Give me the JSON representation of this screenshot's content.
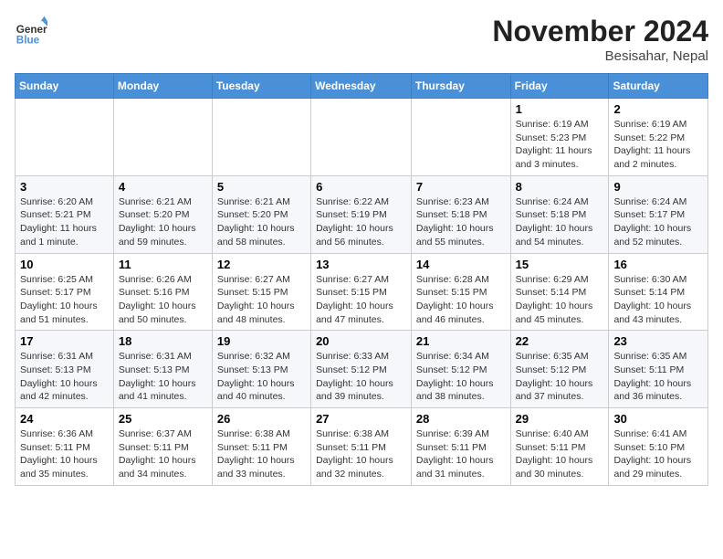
{
  "logo": {
    "line1": "General",
    "line2": "Blue"
  },
  "title": "November 2024",
  "location": "Besisahar, Nepal",
  "weekdays": [
    "Sunday",
    "Monday",
    "Tuesday",
    "Wednesday",
    "Thursday",
    "Friday",
    "Saturday"
  ],
  "weeks": [
    [
      {
        "day": "",
        "info": ""
      },
      {
        "day": "",
        "info": ""
      },
      {
        "day": "",
        "info": ""
      },
      {
        "day": "",
        "info": ""
      },
      {
        "day": "",
        "info": ""
      },
      {
        "day": "1",
        "info": "Sunrise: 6:19 AM\nSunset: 5:23 PM\nDaylight: 11 hours and 3 minutes."
      },
      {
        "day": "2",
        "info": "Sunrise: 6:19 AM\nSunset: 5:22 PM\nDaylight: 11 hours and 2 minutes."
      }
    ],
    [
      {
        "day": "3",
        "info": "Sunrise: 6:20 AM\nSunset: 5:21 PM\nDaylight: 11 hours and 1 minute."
      },
      {
        "day": "4",
        "info": "Sunrise: 6:21 AM\nSunset: 5:20 PM\nDaylight: 10 hours and 59 minutes."
      },
      {
        "day": "5",
        "info": "Sunrise: 6:21 AM\nSunset: 5:20 PM\nDaylight: 10 hours and 58 minutes."
      },
      {
        "day": "6",
        "info": "Sunrise: 6:22 AM\nSunset: 5:19 PM\nDaylight: 10 hours and 56 minutes."
      },
      {
        "day": "7",
        "info": "Sunrise: 6:23 AM\nSunset: 5:18 PM\nDaylight: 10 hours and 55 minutes."
      },
      {
        "day": "8",
        "info": "Sunrise: 6:24 AM\nSunset: 5:18 PM\nDaylight: 10 hours and 54 minutes."
      },
      {
        "day": "9",
        "info": "Sunrise: 6:24 AM\nSunset: 5:17 PM\nDaylight: 10 hours and 52 minutes."
      }
    ],
    [
      {
        "day": "10",
        "info": "Sunrise: 6:25 AM\nSunset: 5:17 PM\nDaylight: 10 hours and 51 minutes."
      },
      {
        "day": "11",
        "info": "Sunrise: 6:26 AM\nSunset: 5:16 PM\nDaylight: 10 hours and 50 minutes."
      },
      {
        "day": "12",
        "info": "Sunrise: 6:27 AM\nSunset: 5:15 PM\nDaylight: 10 hours and 48 minutes."
      },
      {
        "day": "13",
        "info": "Sunrise: 6:27 AM\nSunset: 5:15 PM\nDaylight: 10 hours and 47 minutes."
      },
      {
        "day": "14",
        "info": "Sunrise: 6:28 AM\nSunset: 5:15 PM\nDaylight: 10 hours and 46 minutes."
      },
      {
        "day": "15",
        "info": "Sunrise: 6:29 AM\nSunset: 5:14 PM\nDaylight: 10 hours and 45 minutes."
      },
      {
        "day": "16",
        "info": "Sunrise: 6:30 AM\nSunset: 5:14 PM\nDaylight: 10 hours and 43 minutes."
      }
    ],
    [
      {
        "day": "17",
        "info": "Sunrise: 6:31 AM\nSunset: 5:13 PM\nDaylight: 10 hours and 42 minutes."
      },
      {
        "day": "18",
        "info": "Sunrise: 6:31 AM\nSunset: 5:13 PM\nDaylight: 10 hours and 41 minutes."
      },
      {
        "day": "19",
        "info": "Sunrise: 6:32 AM\nSunset: 5:13 PM\nDaylight: 10 hours and 40 minutes."
      },
      {
        "day": "20",
        "info": "Sunrise: 6:33 AM\nSunset: 5:12 PM\nDaylight: 10 hours and 39 minutes."
      },
      {
        "day": "21",
        "info": "Sunrise: 6:34 AM\nSunset: 5:12 PM\nDaylight: 10 hours and 38 minutes."
      },
      {
        "day": "22",
        "info": "Sunrise: 6:35 AM\nSunset: 5:12 PM\nDaylight: 10 hours and 37 minutes."
      },
      {
        "day": "23",
        "info": "Sunrise: 6:35 AM\nSunset: 5:11 PM\nDaylight: 10 hours and 36 minutes."
      }
    ],
    [
      {
        "day": "24",
        "info": "Sunrise: 6:36 AM\nSunset: 5:11 PM\nDaylight: 10 hours and 35 minutes."
      },
      {
        "day": "25",
        "info": "Sunrise: 6:37 AM\nSunset: 5:11 PM\nDaylight: 10 hours and 34 minutes."
      },
      {
        "day": "26",
        "info": "Sunrise: 6:38 AM\nSunset: 5:11 PM\nDaylight: 10 hours and 33 minutes."
      },
      {
        "day": "27",
        "info": "Sunrise: 6:38 AM\nSunset: 5:11 PM\nDaylight: 10 hours and 32 minutes."
      },
      {
        "day": "28",
        "info": "Sunrise: 6:39 AM\nSunset: 5:11 PM\nDaylight: 10 hours and 31 minutes."
      },
      {
        "day": "29",
        "info": "Sunrise: 6:40 AM\nSunset: 5:11 PM\nDaylight: 10 hours and 30 minutes."
      },
      {
        "day": "30",
        "info": "Sunrise: 6:41 AM\nSunset: 5:10 PM\nDaylight: 10 hours and 29 minutes."
      }
    ]
  ]
}
